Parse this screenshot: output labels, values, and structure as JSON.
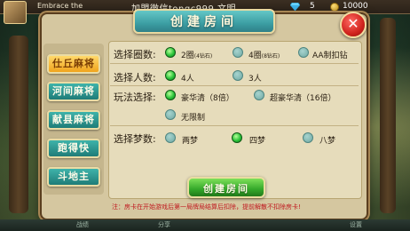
{
  "topbar": {
    "player_name": "Embrace the",
    "promo_text": "加盟微信tongc999  文明",
    "gem_count": "5",
    "coin_count": "10000",
    "icons": [
      "gem-icon",
      "coin-icon"
    ]
  },
  "dialog": {
    "title": "创建房间",
    "close_label": "✕"
  },
  "game_tabs": [
    {
      "label": "仕丘麻将",
      "active": true
    },
    {
      "label": "河间麻将",
      "active": false
    },
    {
      "label": "献县麻将",
      "active": false
    },
    {
      "label": "跑得快",
      "active": false
    },
    {
      "label": "斗地主",
      "active": false
    }
  ],
  "settings": {
    "rounds": {
      "label": "选择圈数:",
      "options": [
        {
          "label": "2圈",
          "sub": "(4钻石)",
          "selected": true
        },
        {
          "label": "4圈",
          "sub": "(8钻石)",
          "selected": false
        },
        {
          "label": "AA制扣钻",
          "sub": "",
          "selected": false
        }
      ]
    },
    "players": {
      "label": "选择人数:",
      "options": [
        {
          "label": "4人",
          "selected": true
        },
        {
          "label": "3人",
          "selected": false
        }
      ]
    },
    "mode": {
      "label": "玩法选择:",
      "options": [
        {
          "label": "豪华清（8倍）",
          "selected": true
        },
        {
          "label": "超豪华清（16倍）",
          "selected": false
        },
        {
          "label": "无限制",
          "selected": false
        }
      ]
    },
    "dreams": {
      "label": "选择梦数:",
      "options": [
        {
          "label": "两梦",
          "selected": false
        },
        {
          "label": "四梦",
          "selected": true
        },
        {
          "label": "八梦",
          "selected": false
        }
      ]
    }
  },
  "create_button_label": "创建房间",
  "notice": "注：房卡在开始游戏后第一局牌局结算后扣除，提前解散不扣除房卡!",
  "bottom_bar": [
    "战绩",
    "分享",
    "设置"
  ],
  "colors": {
    "accent_teal": "#3c9ea3",
    "active_tab": "#f0a41d",
    "selected_radio": "#2bc43a",
    "close_red": "#d0231d",
    "notice_red": "#c0191f"
  }
}
